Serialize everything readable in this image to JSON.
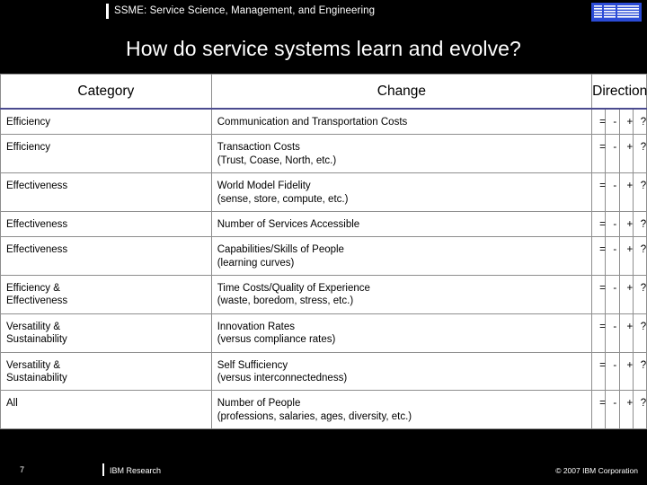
{
  "header": {
    "title": "SSME: Service Science, Management, and Engineering",
    "logo": "ibm-logo"
  },
  "title": "How do service systems learn and evolve?",
  "table": {
    "columns": [
      "Category",
      "Change",
      "Direction"
    ],
    "direction_symbols": [
      "=",
      "-",
      "+",
      "?"
    ],
    "rows": [
      {
        "category": "Efficiency",
        "change_line1": "Communication and Transportation Costs",
        "change_line2": "",
        "direction": [
          "=",
          "-",
          "+",
          "?"
        ]
      },
      {
        "category": "Efficiency",
        "change_line1": "Transaction Costs",
        "change_line2": "(Trust, Coase, North, etc.)",
        "direction": [
          "=",
          "-",
          "+",
          "?"
        ]
      },
      {
        "category": "Effectiveness",
        "change_line1": "World Model Fidelity",
        "change_line2": "(sense, store, compute, etc.)",
        "direction": [
          "=",
          "-",
          "+",
          "?"
        ]
      },
      {
        "category": "Effectiveness",
        "change_line1": "Number of Services Accessible",
        "change_line2": "",
        "direction": [
          "=",
          "-",
          "+",
          "?"
        ]
      },
      {
        "category": "Effectiveness",
        "change_line1": "Capabilities/Skills of People",
        "change_line2": "(learning curves)",
        "direction": [
          "=",
          "-",
          "+",
          "?"
        ]
      },
      {
        "category": "Efficiency &",
        "category_line2": "Effectiveness",
        "change_line1": "Time Costs/Quality of Experience",
        "change_line2": "(waste, boredom, stress, etc.)",
        "direction": [
          "=",
          "-",
          "+",
          "?"
        ]
      },
      {
        "category": "Versatility &",
        "category_line2": "Sustainability",
        "change_line1": "Innovation Rates",
        "change_line2": "(versus compliance rates)",
        "direction": [
          "=",
          "-",
          "+",
          "?"
        ]
      },
      {
        "category": "Versatility &",
        "category_line2": "Sustainability",
        "change_line1": "Self Sufficiency",
        "change_line2": "(versus interconnectedness)",
        "direction": [
          "=",
          "-",
          "+",
          "?"
        ]
      },
      {
        "category": "All",
        "category_line2": "",
        "change_line1": "Number of People",
        "change_line2": "(professions, salaries, ages, diversity, etc.)",
        "direction": [
          "=",
          "-",
          "+",
          "?"
        ]
      }
    ]
  },
  "footer": {
    "page_number": "7",
    "label": "IBM Research",
    "copyright": "© 2007 IBM Corporation"
  },
  "colors": {
    "background": "#000000",
    "table_bg": "#ffffff",
    "header_rule": "#4b4b8f",
    "logo_blue": "#2b4bd6"
  }
}
